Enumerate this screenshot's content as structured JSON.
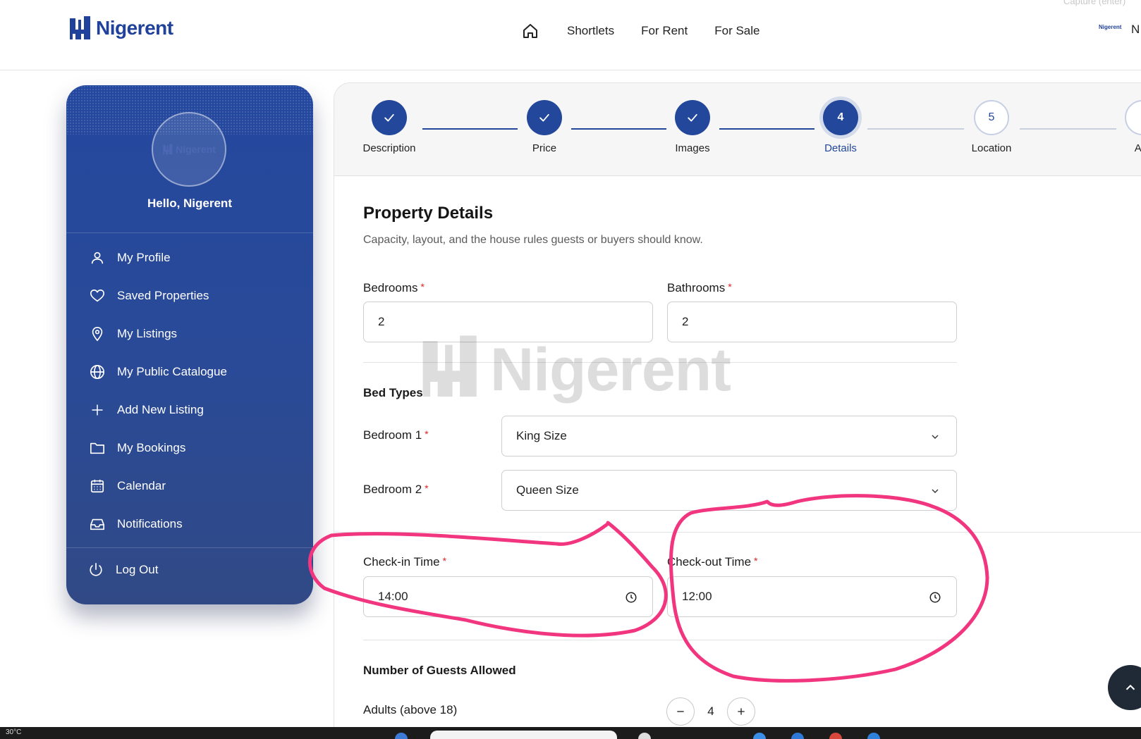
{
  "header": {
    "brand": "Nigerent",
    "nav": [
      {
        "icon": "home-icon"
      },
      {
        "label": "Shortlets"
      },
      {
        "label": "For Rent"
      },
      {
        "label": "For Sale"
      }
    ],
    "capture_hint": "Capture (enter)",
    "mini_brand": "Nigerent",
    "truncated_right": "N"
  },
  "sidebar": {
    "avatar_brand": "Nigerent",
    "greeting": "Hello, Nigerent",
    "items": [
      {
        "label": "My Profile",
        "icon": "user-icon"
      },
      {
        "label": "Saved Properties",
        "icon": "heart-icon"
      },
      {
        "label": "My Listings",
        "icon": "map-pin-icon"
      },
      {
        "label": "My Public Catalogue",
        "icon": "globe-icon"
      },
      {
        "label": "Add New Listing",
        "icon": "plus-icon"
      },
      {
        "label": "My Bookings",
        "icon": "folder-icon"
      },
      {
        "label": "Calendar",
        "icon": "calendar-icon"
      },
      {
        "label": "Notifications",
        "icon": "inbox-icon"
      }
    ],
    "logout": {
      "label": "Log Out",
      "icon": "power-icon"
    }
  },
  "stepper": {
    "steps": [
      {
        "label": "Description",
        "state": "done"
      },
      {
        "label": "Price",
        "state": "done"
      },
      {
        "label": "Images",
        "state": "done"
      },
      {
        "label": "Details",
        "number": "4",
        "state": "current"
      },
      {
        "label": "Location",
        "number": "5",
        "state": "todo"
      },
      {
        "label": "Am",
        "state": "todo"
      }
    ]
  },
  "form": {
    "title": "Property Details",
    "subtitle": "Capacity, layout, and the house rules guests or buyers should know.",
    "bedrooms": {
      "label": "Bedrooms",
      "value": "2"
    },
    "bathrooms": {
      "label": "Bathrooms",
      "value": "2"
    },
    "bed_types": {
      "heading": "Bed Types",
      "rows": [
        {
          "label": "Bedroom 1",
          "value": "King Size"
        },
        {
          "label": "Bedroom 2",
          "value": "Queen Size"
        }
      ]
    },
    "checkin": {
      "label": "Check-in Time",
      "value": "14:00"
    },
    "checkout": {
      "label": "Check-out Time",
      "value": "12:00"
    },
    "guests": {
      "heading": "Number of Guests Allowed",
      "adults": {
        "label": "Adults (above 18)",
        "value": "4"
      }
    },
    "required_mark": "*"
  },
  "watermark": "Nigerent",
  "taskbar": {
    "left_text": "30°C"
  },
  "colors": {
    "brand_blue": "#22479b",
    "annotation_pink": "#f2357f",
    "required_red": "#e02424"
  }
}
